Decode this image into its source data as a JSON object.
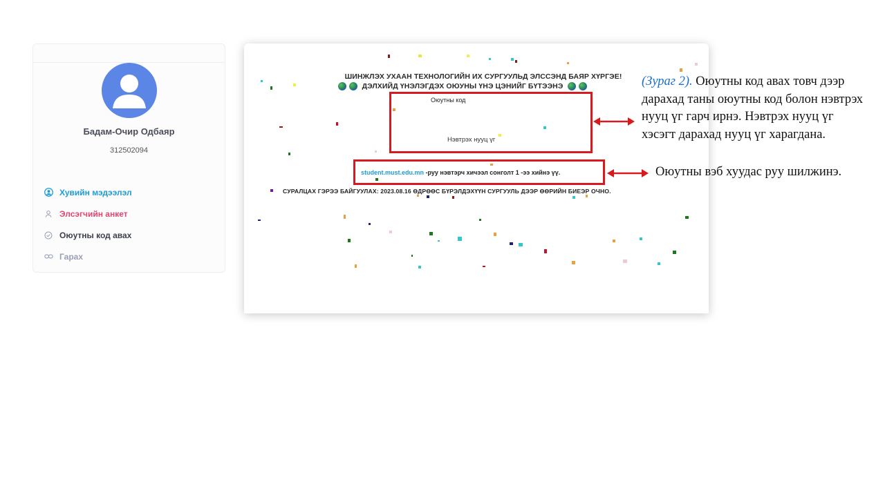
{
  "sidebar": {
    "user_name": "Бадам-Очир Одбаяр",
    "user_id": "312502094",
    "menu": [
      {
        "label": "Хувийн мэдээлэл",
        "icon": "user-circle-icon",
        "color": "#1e9bd7"
      },
      {
        "label": "Элсэгчийн анкет",
        "icon": "user-icon",
        "color": "#e2456f"
      },
      {
        "label": "Оюутны код авах",
        "icon": "check-circle-icon",
        "color": "#3b3f4a"
      },
      {
        "label": "Гарах",
        "icon": "link-icon",
        "color": "#9aa0b4"
      }
    ]
  },
  "main": {
    "headline1": "ШИНЖЛЭХ УХААН ТЕХНОЛОГИЙН ИХ СУРГУУЛЬД ЭЛССЭНД БАЯР ХҮРГЭЕ!",
    "headline2": "ДЭЛХИЙД ҮНЭЛЭГДЭХ ОЮУНЫ ҮНЭ ЦЭНИЙГ БҮТЭЭНЭ",
    "code_label": "Оюутны код",
    "password_label": "Нэвтрэх нууц үг",
    "link_text": "student.must.edu.mn",
    "link_suffix": " -руу нэвтэрч хичээл сонголт 1 -ээ хийнэ үү.",
    "notice": "СУРАЛЦАХ ГЭРЭЭ БАЙГУУЛАХ: 2023.08.16 ӨДРӨӨС БҮРЭЛДЭХҮҮН СУРГУУЛЬ ДЭЭР ӨӨРИЙН БИЕЭР ОЧНО."
  },
  "annotations": {
    "figure_ref": "(Зураг 2).",
    "text1": " Оюутны код авах товч дээр дарахад таны оюутны код болон нэвтрэх нууц үг гарч ирнэ. Нэвтрэх нууц үг хэсэгт дарахад нууц үг харагдана.",
    "text2": "Оюутны вэб хуудас руу шилжинэ."
  },
  "colors": {
    "accent_blue": "#1e9bd7",
    "accent_red": "#d71920",
    "accent_pink": "#e2456f"
  }
}
